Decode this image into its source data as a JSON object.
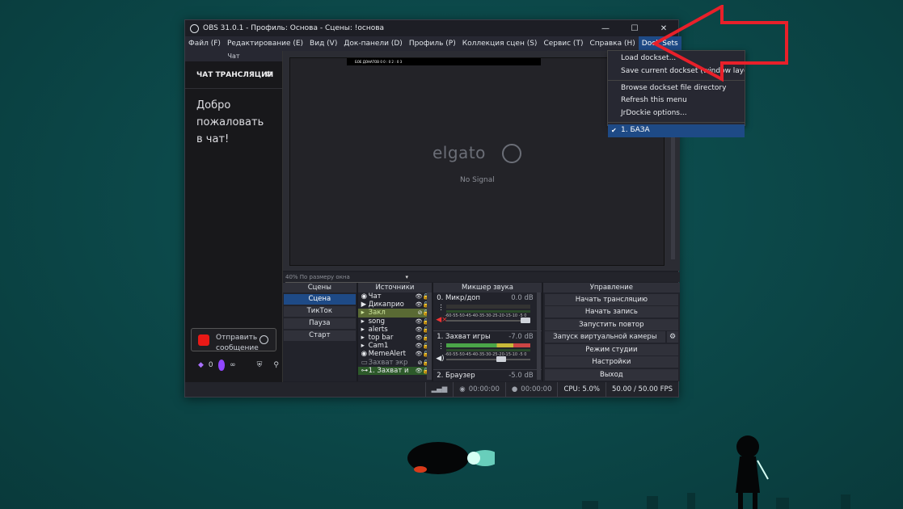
{
  "window": {
    "title": "OBS 31.0.1 - Профиль: Основа - Сцены: !основа",
    "min_glyph": "—",
    "max_glyph": "☐",
    "close_glyph": "✕"
  },
  "menu": [
    "Файл (F)",
    "Редактирование (E)",
    "Вид (V)",
    "Док-панели (D)",
    "Профиль (P)",
    "Коллекция сцен (S)",
    "Сервис (T)",
    "Справка (H)",
    "Dock Sets"
  ],
  "dock_sets_menu": {
    "items": [
      "Load dockset...",
      "Save current dockset (window layout",
      "Browse dockset file directory",
      "Refresh this menu",
      "JrDockie options..."
    ],
    "selected": "1. БАЗА",
    "check": "✔"
  },
  "chat": {
    "header": "Чат",
    "title": "ЧАТ ТРАНСЛЯЦИИ",
    "welcome": "Добро пожаловать в чат!",
    "input_placeholder": "Отправить сообщение",
    "points": "0",
    "infinity": "∞"
  },
  "preview": {
    "strip_text": "БОЕ ДОНАТОВ  0 0 : 0 2 : 0 3",
    "logo_text": "elgato",
    "no_signal": "No Signal",
    "zoom_label": "40% По размеру окна"
  },
  "scenes": {
    "header": "Сцены",
    "items": [
      "Сцена",
      "ТикТок",
      "Пауза",
      "Старт"
    ],
    "selected_index": 0
  },
  "sources": {
    "header": "Источники",
    "items": [
      "Чат",
      "Дикаприо",
      "Закл",
      "song",
      "alerts",
      "top bar",
      "Cam1",
      "MemeAlert",
      "Захват экр",
      "1. Захват и"
    ]
  },
  "mixer": {
    "header": "Микшер звука",
    "channels": [
      {
        "name": "0. Микр/доп",
        "db": "0.0 dB"
      },
      {
        "name": "1. Захват игры",
        "db": "-7.0 dB"
      },
      {
        "name": "2. Браузер",
        "db": "-5.0 dB"
      }
    ],
    "scale": "-60-55-50-45-40-35-30-25-20-15-10 -5 0"
  },
  "controls": {
    "header": "Управление",
    "start_stream": "Начать трансляцию",
    "start_record": "Начать запись",
    "replay": "Запустить повтор",
    "virtual_cam": "Запуск виртуальной камеры",
    "studio_mode": "Режим студии",
    "settings": "Настройки",
    "exit": "Выход"
  },
  "status": {
    "stream_time": "00:00:00",
    "record_time": "00:00:00",
    "cpu": "CPU: 5.0%",
    "fps": "50.00 / 50.00 FPS"
  },
  "colors": {
    "accent": "#1e4a86",
    "arrow": "#e8202a",
    "wallpaper": "#0c4a4b"
  }
}
